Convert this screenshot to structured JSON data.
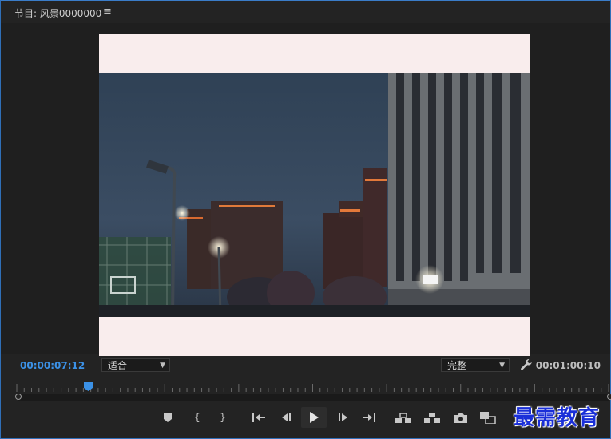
{
  "panel": {
    "title": "节目: 风景0000000",
    "menu_icon": "hamburger-menu-icon"
  },
  "timecode": {
    "current": "00:00:07:12",
    "duration": "00:01:00:10"
  },
  "zoom_select": {
    "value": "适合"
  },
  "quality_select": {
    "value": "完整"
  },
  "playhead_progress": 0.118,
  "controls": [
    {
      "name": "add-marker-button",
      "icon": "marker-icon"
    },
    {
      "name": "mark-in-button",
      "icon": "mark-in-icon",
      "glyph": "{"
    },
    {
      "name": "mark-out-button",
      "icon": "mark-out-icon",
      "glyph": "}"
    },
    {
      "name": "go-to-in-button",
      "icon": "go-to-in-icon"
    },
    {
      "name": "step-back-button",
      "icon": "step-back-icon"
    },
    {
      "name": "play-button",
      "icon": "play-icon"
    },
    {
      "name": "step-forward-button",
      "icon": "step-forward-icon"
    },
    {
      "name": "go-to-out-button",
      "icon": "go-to-out-icon"
    },
    {
      "name": "lift-button",
      "icon": "lift-icon"
    },
    {
      "name": "extract-button",
      "icon": "extract-icon"
    },
    {
      "name": "export-frame-button",
      "icon": "camera-icon"
    },
    {
      "name": "comparison-view-button",
      "icon": "comparison-icon"
    }
  ],
  "watermark": "最需教育",
  "colors": {
    "accent": "#3b91e6",
    "panel_border": "#2f6fb8",
    "frame_bg": "#f9eded"
  }
}
